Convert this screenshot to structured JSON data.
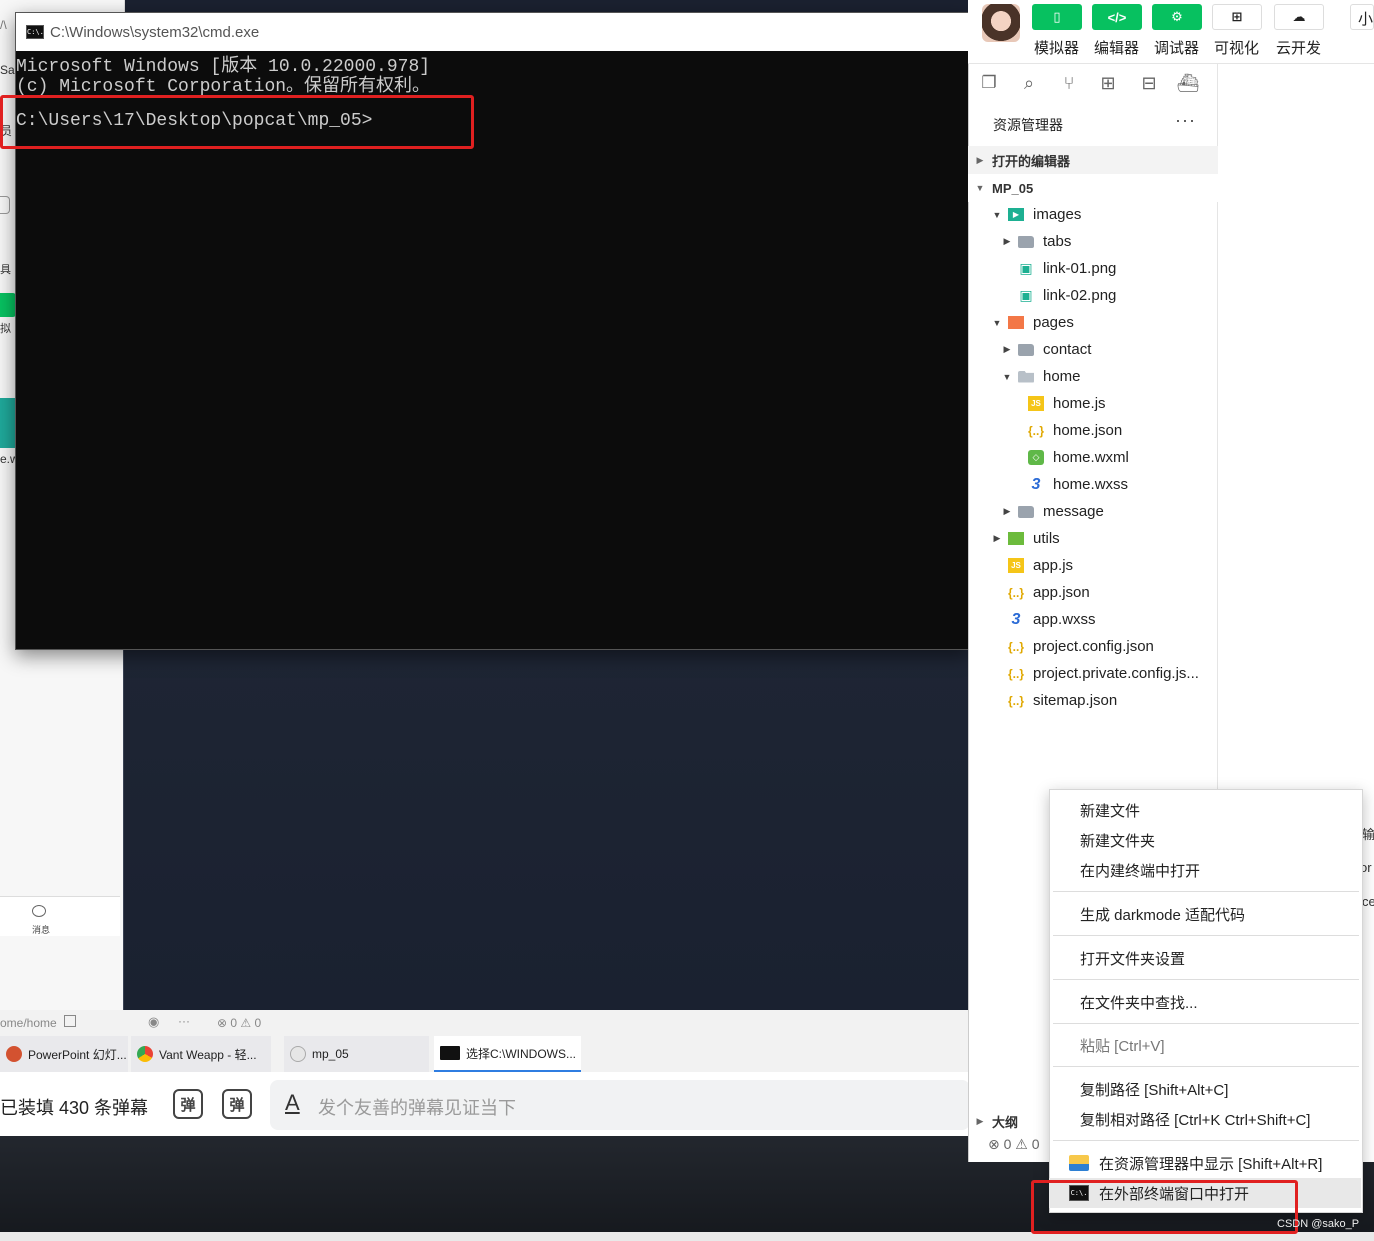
{
  "left_edge": {
    "t1": "/\\",
    "t2": "Sa",
    "t3": "员",
    "t4": "具",
    "t5": "拟",
    "t6": "e.w",
    "msg_label": "消息",
    "path": "ome/home",
    "status": "⊗ 0 ⚠ 0"
  },
  "taskbar": {
    "tabs": [
      {
        "label": "PowerPoint 幻灯..."
      },
      {
        "label": "Vant Weapp - 轻..."
      },
      {
        "label": "mp_05"
      },
      {
        "label": "选择C:\\WINDOWS..."
      }
    ]
  },
  "danmaku": {
    "count_text": "已装填 430 条弹幕",
    "icon1": "弹",
    "icon2": "弹",
    "a_icon": "A",
    "placeholder": "发个友善的弹幕见证当下"
  },
  "cmd": {
    "title": "C:\\Windows\\system32\\cmd.exe",
    "icon_text": "C:\\.",
    "line1": "Microsoft Windows [版本 10.0.22000.978]",
    "line2": "(c) Microsoft Corporation。保留所有权利。",
    "prompt": "C:\\Users\\17\\Desktop\\popcat\\mp_05>"
  },
  "toolbar": {
    "buttons": [
      {
        "label": "模拟器",
        "glyph": "▯"
      },
      {
        "label": "编辑器",
        "glyph": "</>"
      },
      {
        "label": "调试器",
        "glyph": "⚙"
      },
      {
        "label": "可视化",
        "glyph": "⊞"
      },
      {
        "label": "云开发",
        "glyph": "☁"
      },
      {
        "label": "小",
        "glyph": ""
      }
    ]
  },
  "activity_icons": [
    "files-icon",
    "search-icon",
    "source-control-icon",
    "extensions-icon",
    "storage-icon",
    "docker-icon"
  ],
  "explorer": {
    "title": "资源管理器",
    "more": "···",
    "open_editors": "打开的编辑器",
    "project": "MP_05",
    "tree": [
      {
        "label": "images",
        "type": "images",
        "depth": 0,
        "twisty": "▼"
      },
      {
        "label": "tabs",
        "type": "folder",
        "depth": 1,
        "twisty": "▶"
      },
      {
        "label": "link-01.png",
        "type": "png",
        "depth": 1,
        "twisty": ""
      },
      {
        "label": "link-02.png",
        "type": "png",
        "depth": 1,
        "twisty": ""
      },
      {
        "label": "pages",
        "type": "pages",
        "depth": 0,
        "twisty": "▼"
      },
      {
        "label": "contact",
        "type": "folder",
        "depth": 1,
        "twisty": "▶"
      },
      {
        "label": "home",
        "type": "folder-open",
        "depth": 1,
        "twisty": "▼"
      },
      {
        "label": "home.js",
        "type": "js",
        "depth": 2,
        "twisty": ""
      },
      {
        "label": "home.json",
        "type": "json",
        "depth": 2,
        "twisty": ""
      },
      {
        "label": "home.wxml",
        "type": "wxml",
        "depth": 2,
        "twisty": ""
      },
      {
        "label": "home.wxss",
        "type": "wxss",
        "depth": 2,
        "twisty": ""
      },
      {
        "label": "message",
        "type": "folder",
        "depth": 1,
        "twisty": "▶"
      },
      {
        "label": "utils",
        "type": "utils",
        "depth": 0,
        "twisty": "▶"
      },
      {
        "label": "app.js",
        "type": "js",
        "depth": 0,
        "twisty": ""
      },
      {
        "label": "app.json",
        "type": "json",
        "depth": 0,
        "twisty": ""
      },
      {
        "label": "app.wxss",
        "type": "wxss",
        "depth": 0,
        "twisty": ""
      },
      {
        "label": "project.config.json",
        "type": "json",
        "depth": 0,
        "twisty": ""
      },
      {
        "label": "project.private.config.js...",
        "type": "json",
        "depth": 0,
        "twisty": ""
      },
      {
        "label": "sitemap.json",
        "type": "json",
        "depth": 0,
        "twisty": ""
      }
    ],
    "outline": "大纲",
    "status": "⊗ 0 ⚠ 0"
  },
  "right_cut": {
    "t1": "输",
    "t2": "or",
    "t3": "ce"
  },
  "context_menu": {
    "new_file": "新建文件",
    "new_folder": "新建文件夹",
    "open_builtin_terminal": "在内建终端中打开",
    "darkmode": "生成 darkmode 适配代码",
    "folder_settings": "打开文件夹设置",
    "find_in_folder": "在文件夹中查找...",
    "paste": "粘贴  [Ctrl+V]",
    "copy_path": "复制路径  [Shift+Alt+C]",
    "copy_relative_path": "复制相对路径  [Ctrl+K Ctrl+Shift+C]",
    "reveal_in_explorer": "在资源管理器中显示  [Shift+Alt+R]",
    "open_external_terminal": "在外部终端窗口中打开"
  },
  "watermark": "CSDN @sako_P"
}
